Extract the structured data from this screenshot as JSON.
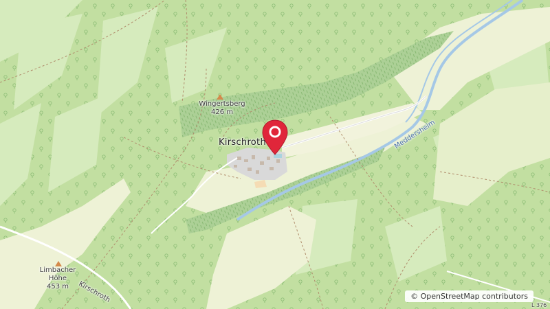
{
  "map": {
    "labels": {
      "town": "Kirschroth",
      "peak1_name": "Wingertsberg",
      "peak1_elev": "426 m",
      "peak2_line1": "Limbacher",
      "peak2_line2": "Höhe",
      "peak2_elev": "453 m",
      "stream": "Meddersheim",
      "road": "Kirschroth",
      "road_ref": "L 376"
    },
    "marker": {
      "color": "#e0263a",
      "icon": "location-pin-icon"
    },
    "attribution": {
      "symbol": "©",
      "text": "OpenStreetMap contributors"
    },
    "colors": {
      "forest": "#c2dfa1",
      "forest_dark": "#add19e",
      "meadow": "#eef2d6",
      "vineyard": "#acd096",
      "water": "#a5c8e6",
      "road": "#ffffff",
      "residential": "#d9d9d9"
    }
  }
}
